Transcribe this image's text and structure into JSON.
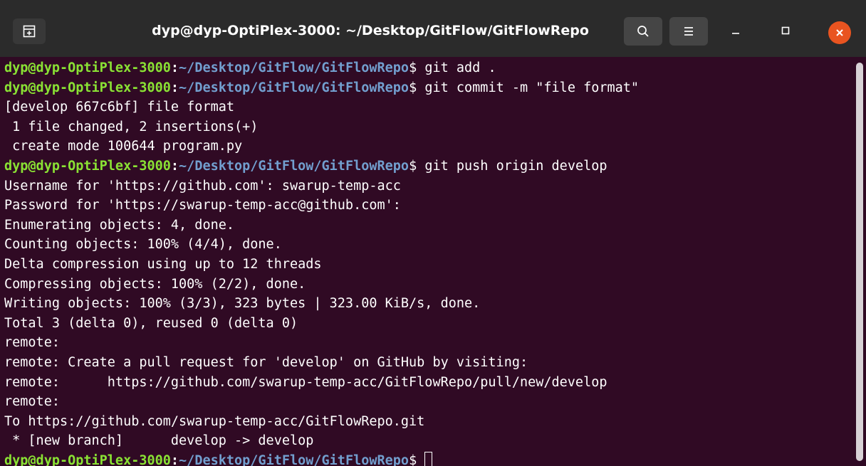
{
  "window": {
    "title": "dyp@dyp-OptiPlex-3000: ~/Desktop/GitFlow/GitFlowRepo"
  },
  "icons": {
    "new_tab": "new-tab-icon",
    "search": "search-icon",
    "menu": "hamburger-menu-icon",
    "minimize": "minimize-icon",
    "maximize": "maximize-icon",
    "close": "close-icon"
  },
  "colors": {
    "terminal_bg": "#300a24",
    "titlebar_bg": "#2b2b2b",
    "prompt_user": "#8ae234",
    "prompt_path": "#729fcf",
    "close_button": "#e95420"
  },
  "prompt": {
    "user": "dyp@dyp-OptiPlex-3000",
    "path": "~/Desktop/GitFlow/GitFlowRepo",
    "symbol": "$"
  },
  "lines": [
    {
      "type": "prompt",
      "command": " git add ."
    },
    {
      "type": "prompt",
      "command": " git commit -m \"file format\""
    },
    {
      "type": "output",
      "text": "[develop 667c6bf] file format"
    },
    {
      "type": "output",
      "text": " 1 file changed, 2 insertions(+)"
    },
    {
      "type": "output",
      "text": " create mode 100644 program.py"
    },
    {
      "type": "prompt",
      "command": " git push origin develop"
    },
    {
      "type": "output",
      "text": "Username for 'https://github.com': swarup-temp-acc"
    },
    {
      "type": "output",
      "text": "Password for 'https://swarup-temp-acc@github.com':"
    },
    {
      "type": "output",
      "text": "Enumerating objects: 4, done."
    },
    {
      "type": "output",
      "text": "Counting objects: 100% (4/4), done."
    },
    {
      "type": "output",
      "text": "Delta compression using up to 12 threads"
    },
    {
      "type": "output",
      "text": "Compressing objects: 100% (2/2), done."
    },
    {
      "type": "output",
      "text": "Writing objects: 100% (3/3), 323 bytes | 323.00 KiB/s, done."
    },
    {
      "type": "output",
      "text": "Total 3 (delta 0), reused 0 (delta 0)"
    },
    {
      "type": "output",
      "text": "remote:"
    },
    {
      "type": "output",
      "text": "remote: Create a pull request for 'develop' on GitHub by visiting:"
    },
    {
      "type": "output",
      "text": "remote:      https://github.com/swarup-temp-acc/GitFlowRepo/pull/new/develop"
    },
    {
      "type": "output",
      "text": "remote:"
    },
    {
      "type": "output",
      "text": "To https://github.com/swarup-temp-acc/GitFlowRepo.git"
    },
    {
      "type": "output",
      "text": " * [new branch]      develop -> develop"
    },
    {
      "type": "prompt",
      "command": " ",
      "cursor": true
    }
  ]
}
